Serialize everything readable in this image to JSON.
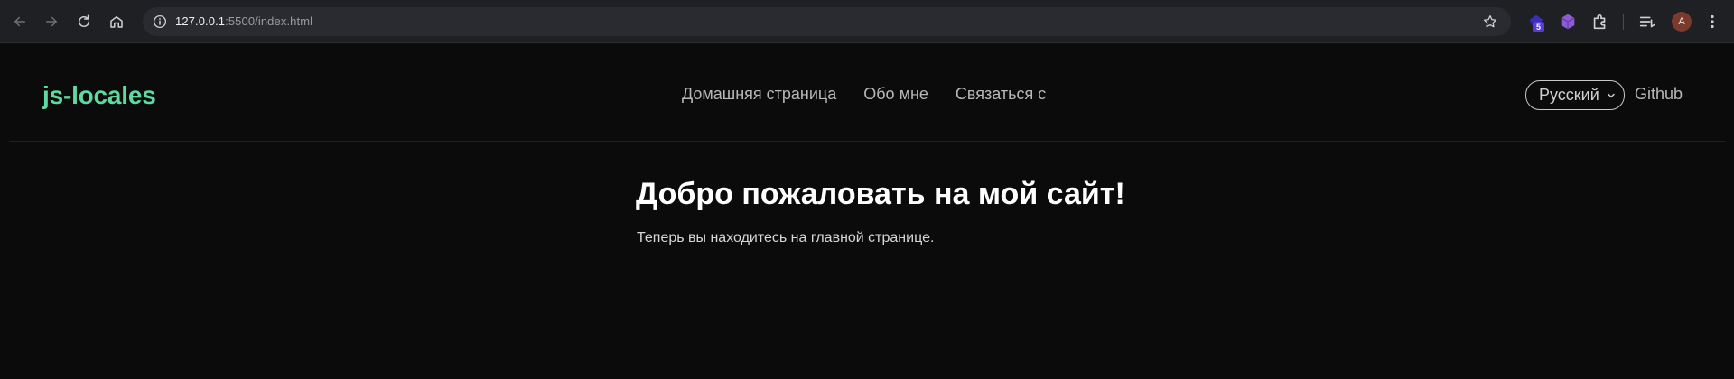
{
  "browser": {
    "url_host": "127.0.0.1",
    "url_port_path": ":5500/index.html",
    "extension_badge": "5",
    "profile_initial": "A",
    "icons": {
      "back": "arrow-left-icon",
      "forward": "arrow-right-icon",
      "reload": "reload-icon",
      "home": "home-icon",
      "site_info": "info-icon",
      "bookmark": "star-icon",
      "extensions": "puzzle-icon",
      "reading_list": "reading-list-icon",
      "menu": "kebab-menu-icon"
    }
  },
  "site": {
    "logo": "js-locales",
    "nav": [
      "Домашняя страница",
      "Обо мне",
      "Связаться с"
    ],
    "language_select": "Русский",
    "github_link": "Github"
  },
  "main": {
    "title": "Добро пожаловать на мой сайт!",
    "text": "Теперь вы находитесь на главной странице."
  },
  "colors": {
    "page_bg": "#0b0b0b",
    "chrome_bg": "#1f2024",
    "logo": "#5ed9a0",
    "nav_text": "#b8b8bb"
  }
}
